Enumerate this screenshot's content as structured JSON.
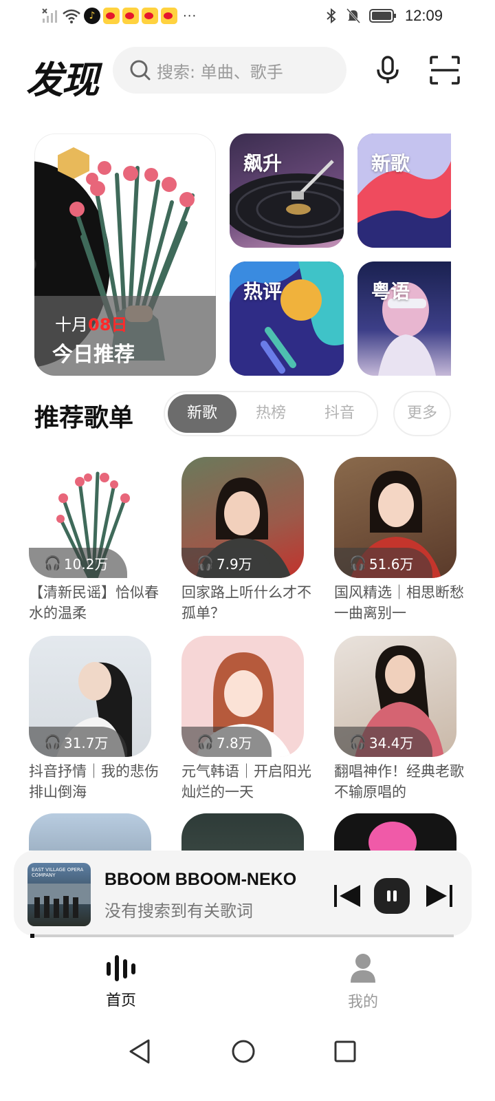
{
  "status_bar": {
    "time": "12:09",
    "left_icons": [
      "signal-off-icon",
      "wifi-icon",
      "tiktok-icon",
      "weibo-icon",
      "weibo-icon",
      "weibo-icon",
      "weibo-icon",
      "more-dots-icon"
    ],
    "right_icons": [
      "bluetooth-icon",
      "mute-icon",
      "battery-icon"
    ],
    "dots": "···"
  },
  "header": {
    "title": "发现",
    "search_placeholder": "搜索: 单曲、歌手"
  },
  "banner": {
    "month": "十月",
    "day": "08日",
    "title": "今日推荐"
  },
  "tiles": {
    "rise": "飙升",
    "new": "新歌",
    "hot_comments": "热评",
    "cantonese": "粤语"
  },
  "playlists_section": {
    "title": "推荐歌单",
    "tabs": [
      {
        "label": "新歌",
        "active": true
      },
      {
        "label": "热榜",
        "active": false
      },
      {
        "label": "抖音",
        "active": false
      }
    ],
    "more": "更多"
  },
  "playlists": [
    {
      "plays": "10.2万",
      "title": "【清新民谣】恰似春水的温柔"
    },
    {
      "plays": "7.9万",
      "title": "回家路上听什么才不孤单？"
    },
    {
      "plays": "51.6万",
      "title": "国风精选｜相思断愁一曲离别一"
    },
    {
      "plays": "31.7万",
      "title": "抖音抒情｜我的悲伤排山倒海"
    },
    {
      "plays": "7.8万",
      "title": "元气韩语｜开启阳光灿烂的一天"
    },
    {
      "plays": "34.4万",
      "title": "翻唱神作！经典老歌不输原唱的"
    }
  ],
  "player": {
    "song": "BBOOM BBOOM-NEKO",
    "lyric": "没有搜索到有关歌词",
    "album_text": "EAST VILLAGE OPERA COMPANY",
    "progress": 0.01
  },
  "bottom_nav": {
    "home": "首页",
    "mine": "我的"
  }
}
